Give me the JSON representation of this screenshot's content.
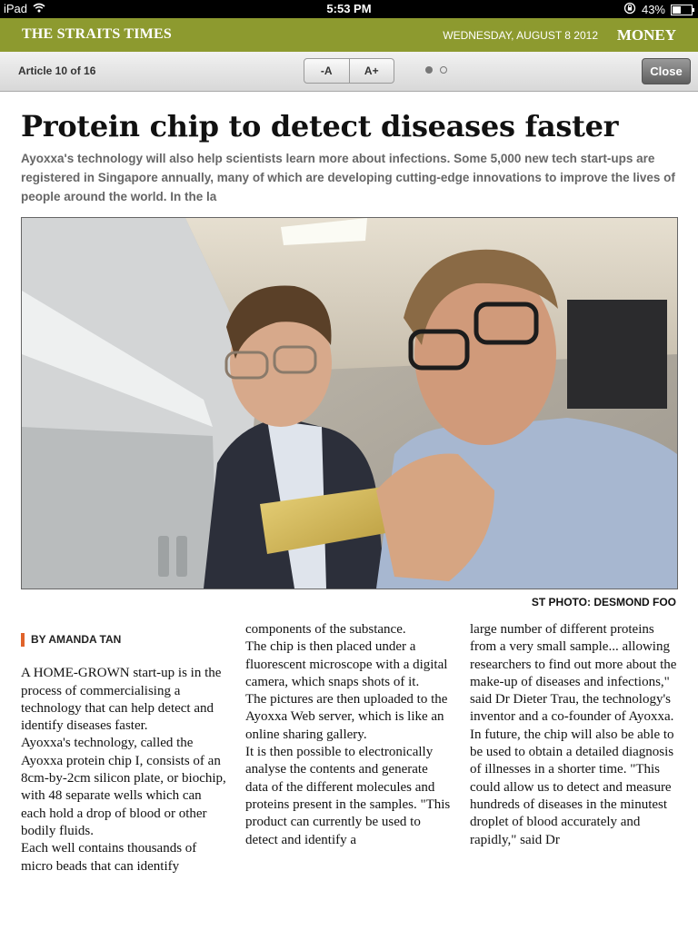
{
  "status_bar": {
    "device": "iPad",
    "time": "5:53 PM",
    "battery": "43%",
    "battery_level": 0.43
  },
  "masthead": {
    "brand": "THE STRAITS TIMES",
    "date": "WEDNESDAY, AUGUST 8 2012",
    "section": "MONEY"
  },
  "toolbar": {
    "article_count": "Article 10 of 16",
    "font_smaller": "-A",
    "font_larger": "A+",
    "page_dots": 2,
    "current_page": 1,
    "close": "Close"
  },
  "article": {
    "headline": "Protein chip to detect diseases faster",
    "standfirst": "Ayoxxa's technology will also help scientists learn more about infections. Some 5,000 new tech start-ups are registered in Singapore annually, many of which are developing cutting-edge innovations to improve the lives of people around the world. In the la",
    "photo_credit": "ST PHOTO: DESMOND FOO",
    "byline": "BY AMANDA TAN",
    "col1": [
      "A HOME-GROWN start-up is in the process of commercialising a technology that can help detect and identify diseases faster.",
      " Ayoxxa's technology, called the Ayoxxa protein chip I, consists of an 8cm-by-2cm silicon plate, or biochip, with 48 separate wells which can each hold a drop of blood or other bodily fluids.",
      " Each well contains thousands of micro beads that can identify"
    ],
    "col2": [
      "components of the substance.",
      " The chip is then placed under a fluorescent microscope with a digital camera, which snaps shots of it.",
      " The pictures are then uploaded to the Ayoxxa Web server, which is like an online sharing gallery.",
      " It is then possible to electronically analyse the contents and generate data of the different molecules and proteins present in the samples. \"This product can currently be used to detect and identify a"
    ],
    "col3": [
      "large number of different proteins from a very small sample... allowing researchers to find out more about the make-up of diseases and infections,\" said Dr Dieter Trau, the technology's inventor and a co-founder of Ayoxxa.",
      " In future, the chip will also be able to be used to obtain a detailed diagnosis of illnesses in a shorter time. \"This could allow us to detect and measure hundreds of diseases in the minutest droplet of blood accurately and rapidly,\" said Dr"
    ]
  },
  "colors": {
    "masthead": "#8d9a2f",
    "byline_accent": "#e0632a"
  }
}
